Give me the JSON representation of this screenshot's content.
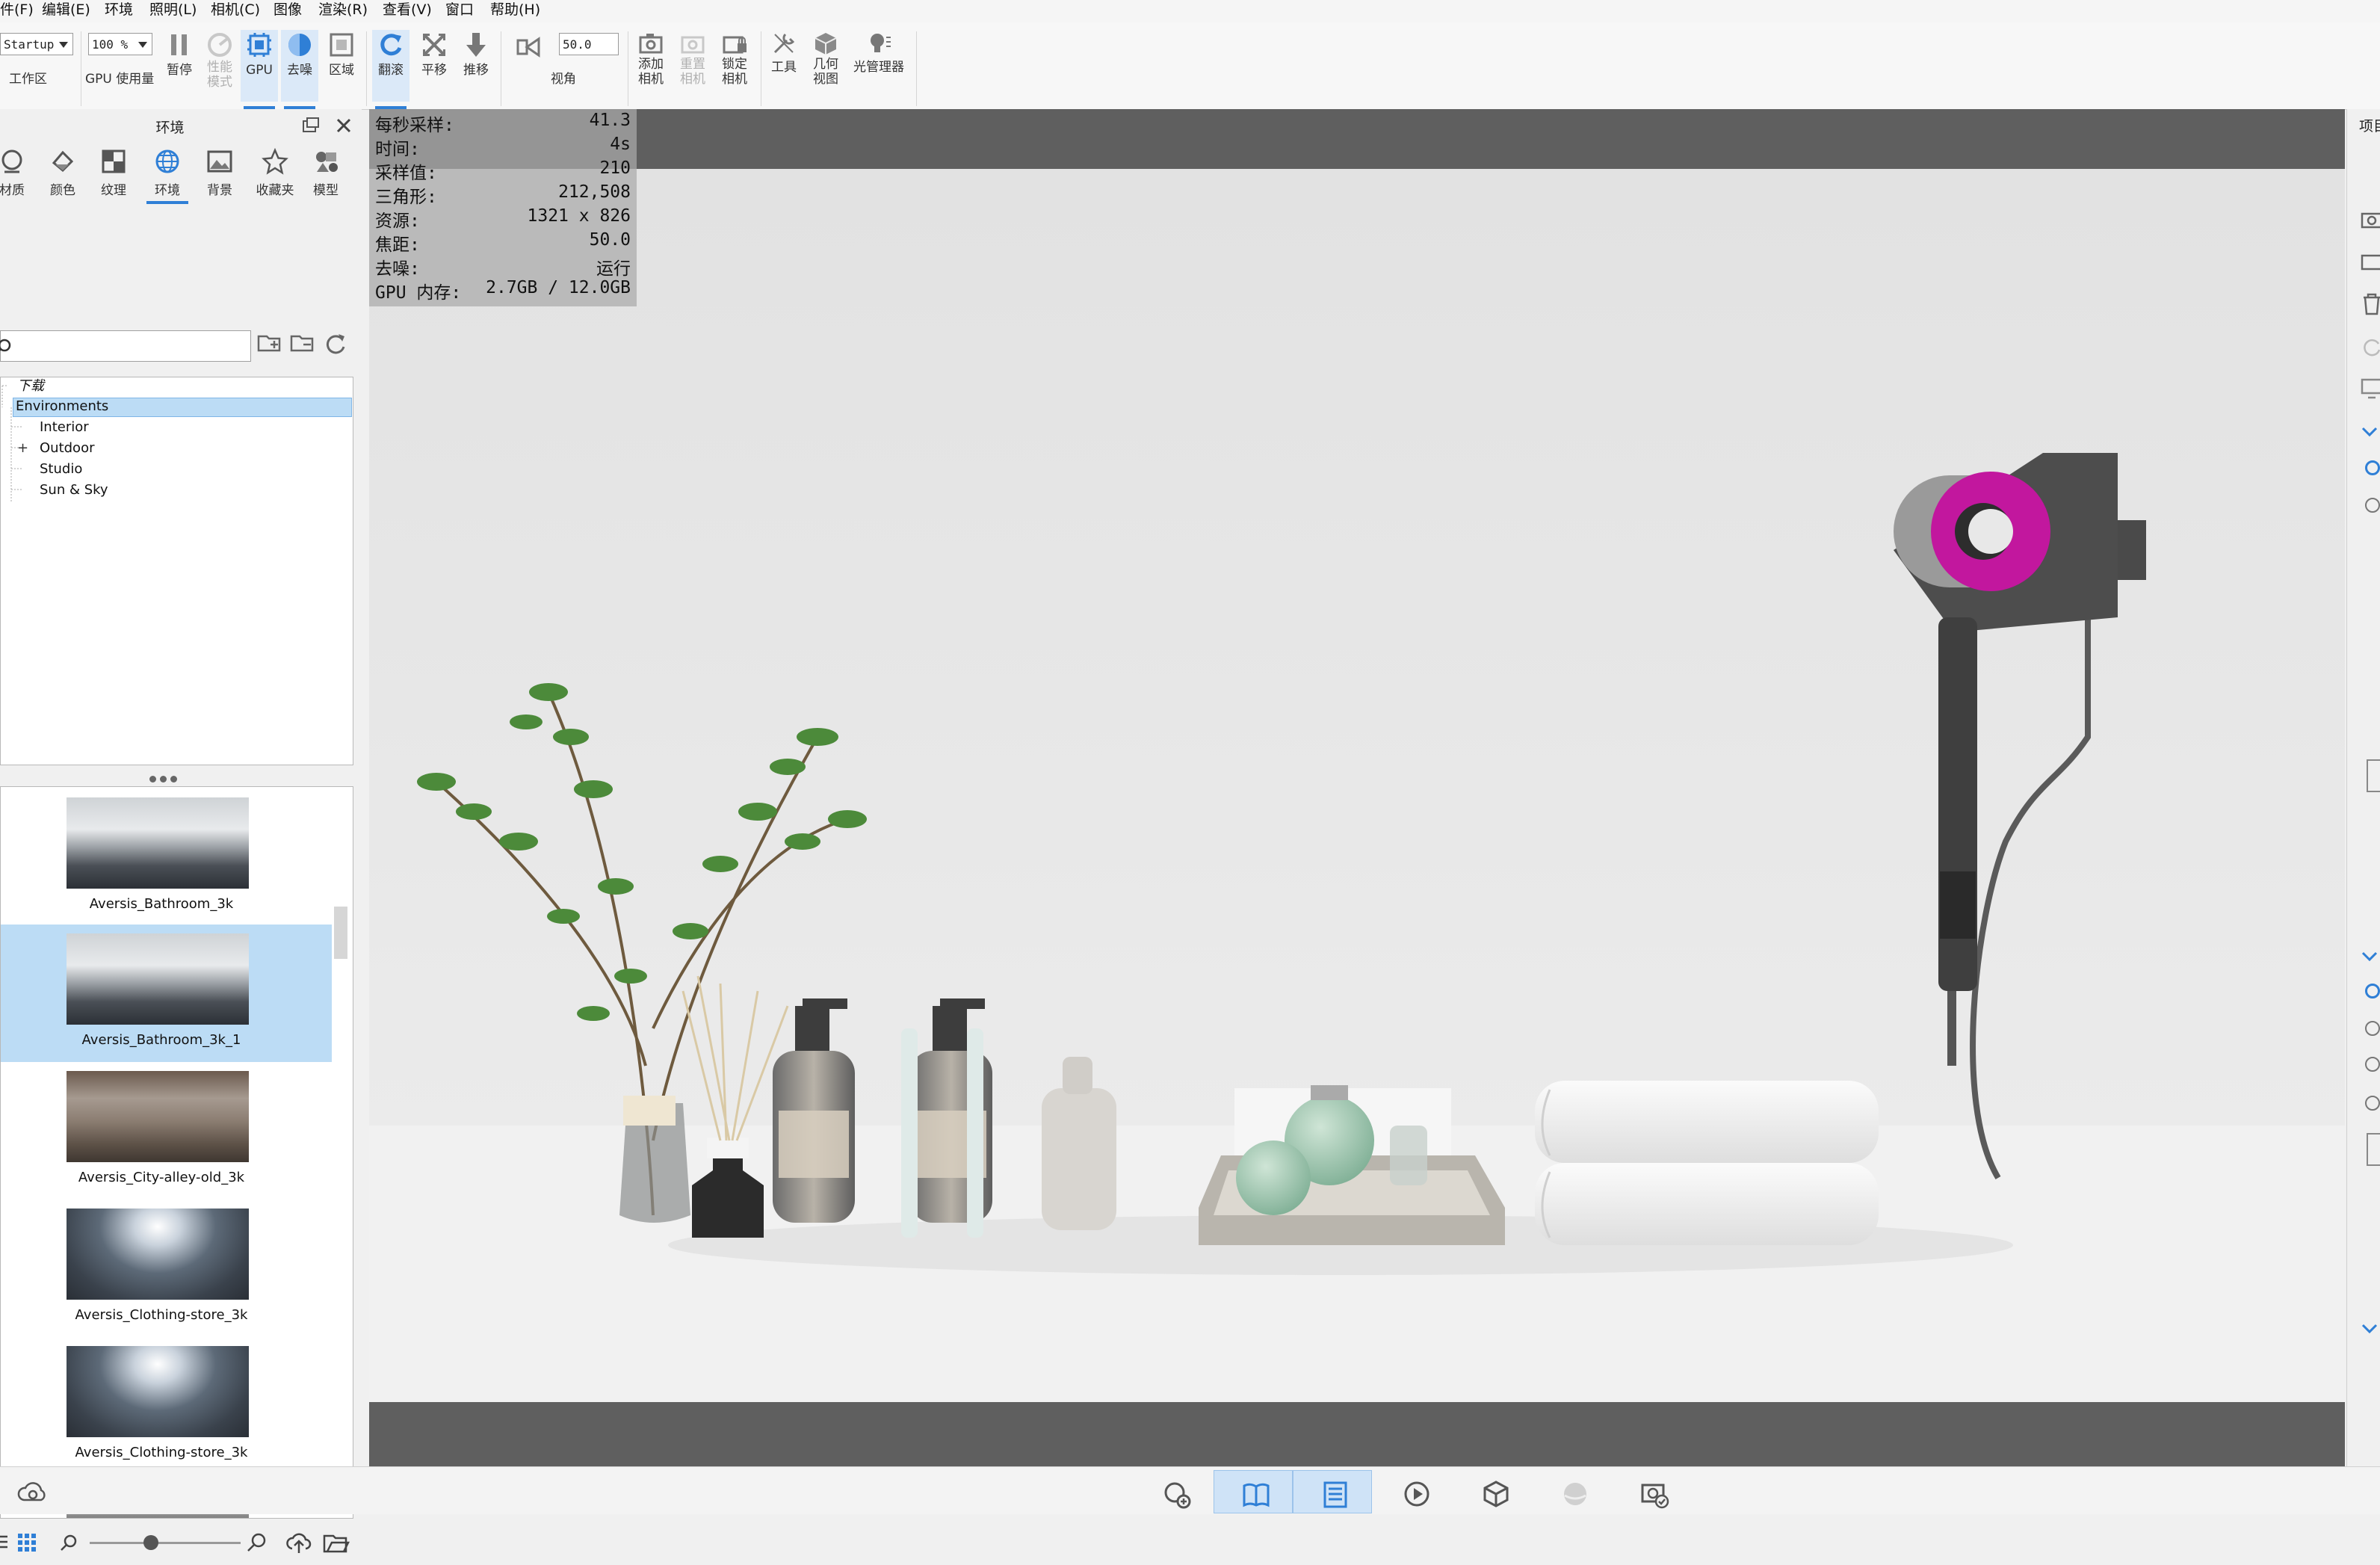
{
  "menu": [
    "件(F)",
    "编辑(E)",
    "环境",
    "照明(L)",
    "相机(C)",
    "图像",
    "渲染(R)",
    "查看(V)",
    "窗口",
    "帮助(H)"
  ],
  "toolbar": {
    "workspace_value": "Startup",
    "workspace_label": "工作区",
    "gpu_usage_value": "100 %",
    "gpu_usage_label": "GPU 使用量",
    "pause_label": "暂停",
    "perf_mode_label": "性能模式",
    "gpu_label": "GPU",
    "denoise_label": "去噪",
    "region_label": "区域",
    "tumble_label": "翻滚",
    "pan_label": "平移",
    "dolly_label": "推移",
    "fov_value": "50.0",
    "fov_label": "视角",
    "add_camera_label": "添加相机",
    "reset_camera_label": "重置相机",
    "lock_camera_label": "锁定相机",
    "tools_label": "工具",
    "geometry_view_label": "几何视图",
    "light_manager_label": "光管理器"
  },
  "left_panel": {
    "title": "环境",
    "tabs": [
      "材质",
      "颜色",
      "纹理",
      "环境",
      "背景",
      "收藏夹",
      "模型"
    ],
    "active_tab": "环境",
    "search_placeholder": "",
    "tree": {
      "root": "下载",
      "selected": "Environments",
      "children": [
        "Interior",
        "Outdoor",
        "Studio",
        "Sun & Sky"
      ]
    },
    "thumbnails": [
      {
        "name": "Aversis_Bathroom_3k",
        "selected": false
      },
      {
        "name": "Aversis_Bathroom_3k_1",
        "selected": true
      },
      {
        "name": "Aversis_City-alley-old_3k",
        "selected": false
      },
      {
        "name": "Aversis_Clothing-store_3k",
        "selected": false
      },
      {
        "name": "Aversis_Clothing-store_3k",
        "selected": false
      }
    ]
  },
  "stats": [
    {
      "key": "每秒采样:",
      "value": "41.3"
    },
    {
      "key": "时间:",
      "value": "4s"
    },
    {
      "key": "采样值:",
      "value": "210"
    },
    {
      "key": "三角形:",
      "value": "212,508"
    },
    {
      "key": "资源:",
      "value": "1321 x 826"
    },
    {
      "key": "焦距:",
      "value": "50.0"
    },
    {
      "key": "去噪:",
      "value": "运行"
    },
    {
      "key": "GPU 内存:",
      "value": "2.7GB / 12.0GB"
    }
  ],
  "right_panel": {
    "title_fragment": "项目"
  },
  "colors": {
    "accent": "#2f7fd6",
    "selection": "#bcdcf5",
    "viewport_bg": "#5f5f5f",
    "hair_dryer_ring": "#c2179e"
  }
}
